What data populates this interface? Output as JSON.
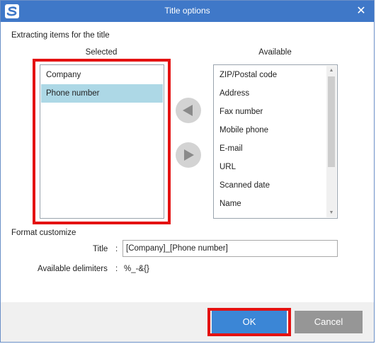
{
  "window": {
    "title": "Title options",
    "close_glyph": "✕",
    "app_icon": "scansnap-icon"
  },
  "extracting": {
    "heading": "Extracting items for the title",
    "selected_header": "Selected",
    "available_header": "Available",
    "selected_items": [
      {
        "label": "Company",
        "selected": false
      },
      {
        "label": "Phone number",
        "selected": true
      }
    ],
    "available_items": [
      "ZIP/Postal code",
      "Address",
      "Fax number",
      "Mobile phone",
      "E-mail",
      "URL",
      "Scanned date",
      "Name"
    ],
    "move_left_icon": "arrow-left-icon",
    "move_right_icon": "arrow-right-icon"
  },
  "format": {
    "heading": "Format customize",
    "title_label": "Title",
    "colon": ":",
    "title_value": "[Company]_[Phone number]",
    "delimiters_label": "Available delimiters",
    "delimiters_value": "%_-&{}"
  },
  "footer": {
    "ok_label": "OK",
    "cancel_label": "Cancel"
  },
  "colors": {
    "titlebar": "#3f78c8",
    "highlight": "#e41212",
    "selection": "#add8e6",
    "ok_button": "#3b86d6",
    "cancel_button": "#969696"
  }
}
